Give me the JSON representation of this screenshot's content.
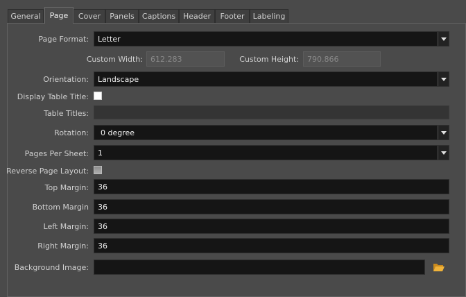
{
  "tabs": [
    {
      "label": "General"
    },
    {
      "label": "Page"
    },
    {
      "label": "Cover"
    },
    {
      "label": "Panels"
    },
    {
      "label": "Captions"
    },
    {
      "label": "Header"
    },
    {
      "label": "Footer"
    },
    {
      "label": "Labeling"
    }
  ],
  "active_tab": "Page",
  "form": {
    "page_format": {
      "label": "Page Format:",
      "value": "Letter"
    },
    "custom_width": {
      "label": "Custom Width:",
      "value": "612.283"
    },
    "custom_height": {
      "label": "Custom Height:",
      "value": "790.866"
    },
    "orientation": {
      "label": "Orientation:",
      "value": "Landscape"
    },
    "display_table_title": {
      "label": "Display Table Title:",
      "checked": false
    },
    "table_titles": {
      "label": "Table Titles:",
      "value": ""
    },
    "rotation": {
      "label": "Rotation:",
      "value": "0 degree"
    },
    "pages_per_sheet": {
      "label": "Pages Per Sheet:",
      "value": "1"
    },
    "reverse_page_layout": {
      "label": "Reverse Page Layout:",
      "checked": false
    },
    "top_margin": {
      "label": "Top Margin:",
      "value": "36"
    },
    "bottom_margin": {
      "label": "Bottom Margin",
      "value": "36"
    },
    "left_margin": {
      "label": "Left Margin:",
      "value": "36"
    },
    "right_margin": {
      "label": "Right Margin:",
      "value": "36"
    },
    "background_image": {
      "label": "Background Image:",
      "value": ""
    }
  },
  "icons": {
    "dropdown": "chevron-down-icon",
    "browse": "folder-open-icon"
  }
}
